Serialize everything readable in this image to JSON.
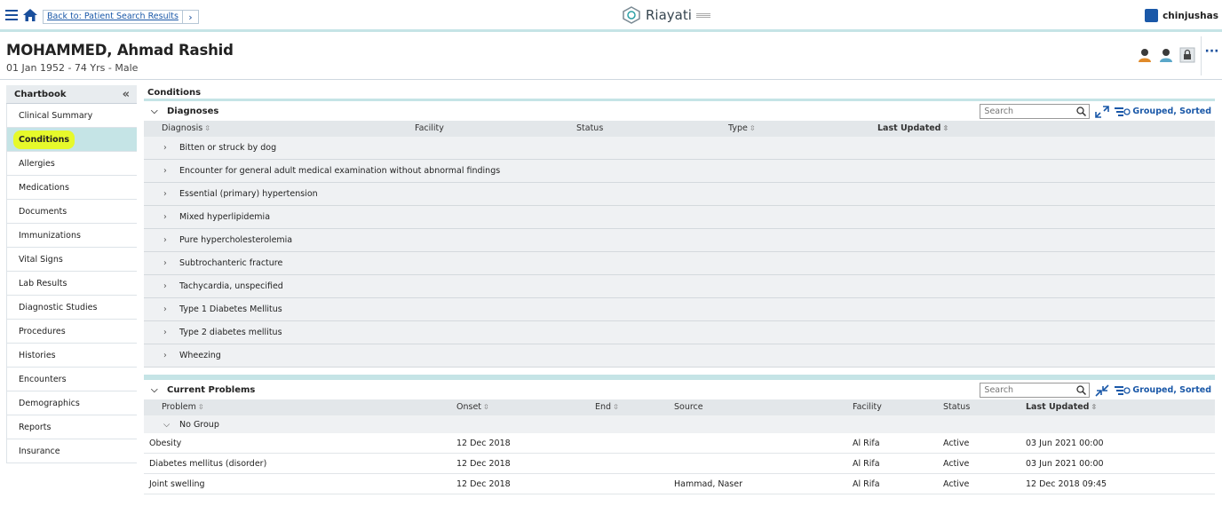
{
  "topbar": {
    "breadcrumb_link": "Back to: Patient Search Results",
    "brand": "Riayati",
    "username": "chinjushas"
  },
  "patient": {
    "name": "MOHAMMED, Ahmad Rashid",
    "demographics": "01 Jan 1952 - 74 Yrs - Male"
  },
  "sidebar": {
    "title": "Chartbook",
    "items": [
      {
        "label": "Clinical Summary"
      },
      {
        "label": "Conditions",
        "active": true
      },
      {
        "label": "Allergies"
      },
      {
        "label": "Medications"
      },
      {
        "label": "Documents"
      },
      {
        "label": "Immunizations"
      },
      {
        "label": "Vital Signs"
      },
      {
        "label": "Lab Results"
      },
      {
        "label": "Diagnostic Studies"
      },
      {
        "label": "Procedures"
      },
      {
        "label": "Histories"
      },
      {
        "label": "Encounters"
      },
      {
        "label": "Demographics"
      },
      {
        "label": "Reports"
      },
      {
        "label": "Insurance"
      }
    ]
  },
  "main": {
    "title": "Conditions",
    "diagnoses": {
      "title": "Diagnoses",
      "search_placeholder": "Search",
      "group_label": "Grouped, Sorted",
      "columns": {
        "diagnosis": "Diagnosis",
        "facility": "Facility",
        "status": "Status",
        "type": "Type",
        "last_updated": "Last Updated"
      },
      "rows": [
        "Bitten or struck by dog",
        "Encounter for general adult medical examination without abnormal findings",
        "Essential (primary) hypertension",
        "Mixed hyperlipidemia",
        "Pure hypercholesterolemia",
        "Subtrochanteric fracture",
        "Tachycardia, unspecified",
        "Type 1 Diabetes Mellitus",
        "Type 2 diabetes mellitus",
        "Wheezing"
      ]
    },
    "problems": {
      "title": "Current Problems",
      "search_placeholder": "Search",
      "group_label": "Grouped, Sorted",
      "columns": {
        "problem": "Problem",
        "onset": "Onset",
        "end": "End",
        "source": "Source",
        "facility": "Facility",
        "status": "Status",
        "last_updated": "Last Updated"
      },
      "group": "No Group",
      "rows": [
        {
          "problem": "Obesity",
          "onset": "12 Dec 2018",
          "end": "",
          "source": "",
          "facility": "Al Rifa",
          "status": "Active",
          "last_updated": "03 Jun 2021 00:00"
        },
        {
          "problem": "Diabetes mellitus (disorder)",
          "onset": "12 Dec 2018",
          "end": "",
          "source": "",
          "facility": "Al Rifa",
          "status": "Active",
          "last_updated": "03 Jun 2021 00:00"
        },
        {
          "problem": "Joint swelling",
          "onset": "12 Dec 2018",
          "end": "",
          "source": "Hammad, Naser",
          "facility": "Al Rifa",
          "status": "Active",
          "last_updated": "12 Dec 2018 09:45"
        }
      ]
    }
  },
  "colors": {
    "accent": "#c5e4e6",
    "link": "#1a58a8",
    "highlight": "#e6f92b"
  }
}
